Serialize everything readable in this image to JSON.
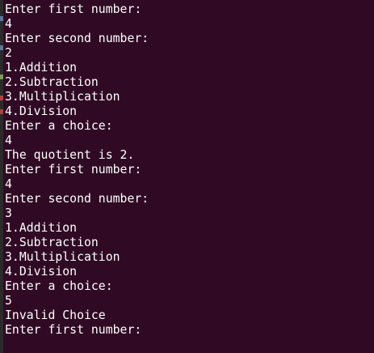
{
  "colors": {
    "background": "#300a24",
    "text": "#ffffff"
  },
  "terminal": {
    "lines": [
      "Enter first number:",
      "4",
      "Enter second number:",
      "2",
      "1.Addition",
      "2.Subtraction",
      "3.Multiplication",
      "4.Division",
      "Enter a choice:",
      "4",
      "The quotient is 2.",
      "Enter first number:",
      "4",
      "Enter second number:",
      "3",
      "1.Addition",
      "2.Subtraction",
      "3.Multiplication",
      "4.Division",
      "Enter a choice:",
      "5",
      "Invalid Choice",
      "Enter first number:"
    ]
  }
}
